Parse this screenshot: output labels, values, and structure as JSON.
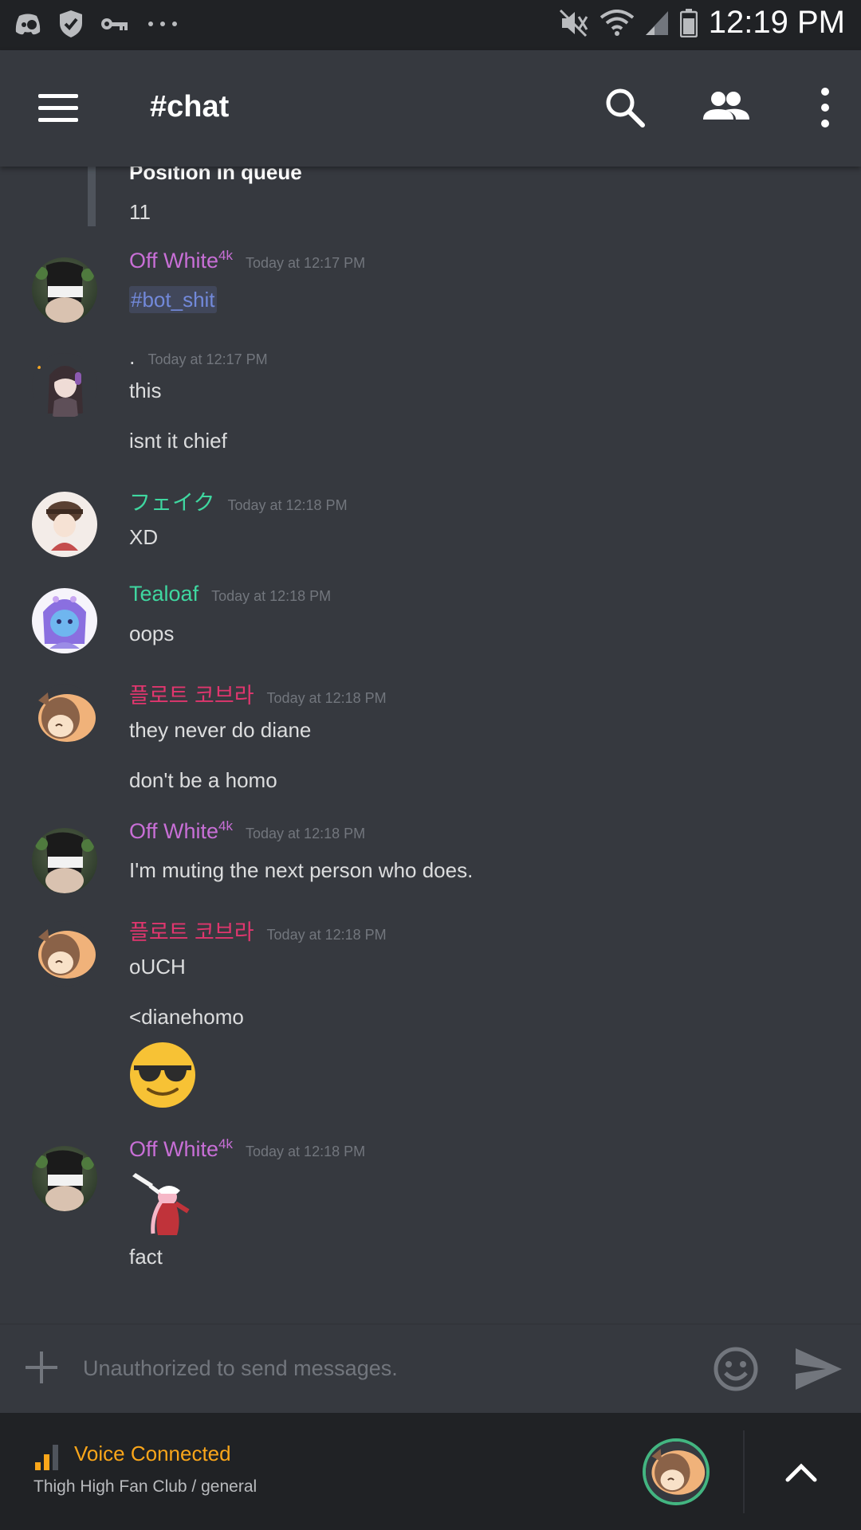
{
  "colors": {
    "background": "#36393f",
    "status_bar": "#202225",
    "off_white_name": "#c86fd6",
    "feiku_name": "#3fd7a0",
    "tealoaf_name": "#3fd7a0",
    "cobra_name": "#e0366e",
    "voice_connected": "#faa61a",
    "voice_ring": "#43b581"
  },
  "status_bar": {
    "time": "12:19 PM",
    "icons": [
      "discord-icon",
      "shield-icon",
      "key-icon",
      "more-dots-icon",
      "mute-icon",
      "wifi-icon",
      "signal-icon",
      "battery-icon"
    ]
  },
  "header": {
    "title": "#chat",
    "icons": [
      "menu-icon",
      "search-icon",
      "members-icon",
      "overflow-menu-icon"
    ]
  },
  "embed": {
    "title": "Position in queue",
    "value": "11"
  },
  "messages": [
    {
      "author": "Off White",
      "author_sup": "4k",
      "timestamp": "Today at 12:17 PM",
      "lines": [
        "#bot_shit"
      ]
    },
    {
      "author": ".",
      "timestamp": "Today at 12:17 PM",
      "lines": [
        "this",
        "isnt it chief"
      ]
    },
    {
      "author": "フェイク",
      "timestamp": "Today at 12:18 PM",
      "lines": [
        "XD"
      ]
    },
    {
      "author": "Tealoaf",
      "timestamp": "Today at 12:18 PM",
      "lines": [
        "oops"
      ]
    },
    {
      "author": "플로트 코브라",
      "timestamp": "Today at 12:18 PM",
      "lines": [
        "they never do diane",
        "don't be a homo"
      ]
    },
    {
      "author": "Off White",
      "author_sup": "4k",
      "timestamp": "Today at 12:18 PM",
      "lines": [
        "I'm muting the next person who does."
      ]
    },
    {
      "author": "플로트 코브라",
      "timestamp": "Today at 12:18 PM",
      "lines": [
        "oUCH",
        "<dianehomo"
      ],
      "emoji": "sunglasses-emoji"
    },
    {
      "author": "Off White",
      "author_sup": "4k",
      "timestamp": "Today at 12:18 PM",
      "image": "dab-sticker",
      "lines": [
        "fact"
      ]
    }
  ],
  "input": {
    "placeholder": "Unauthorized to send messages."
  },
  "voice": {
    "status": "Voice Connected",
    "channel": "Thigh High Fan Club / general"
  }
}
